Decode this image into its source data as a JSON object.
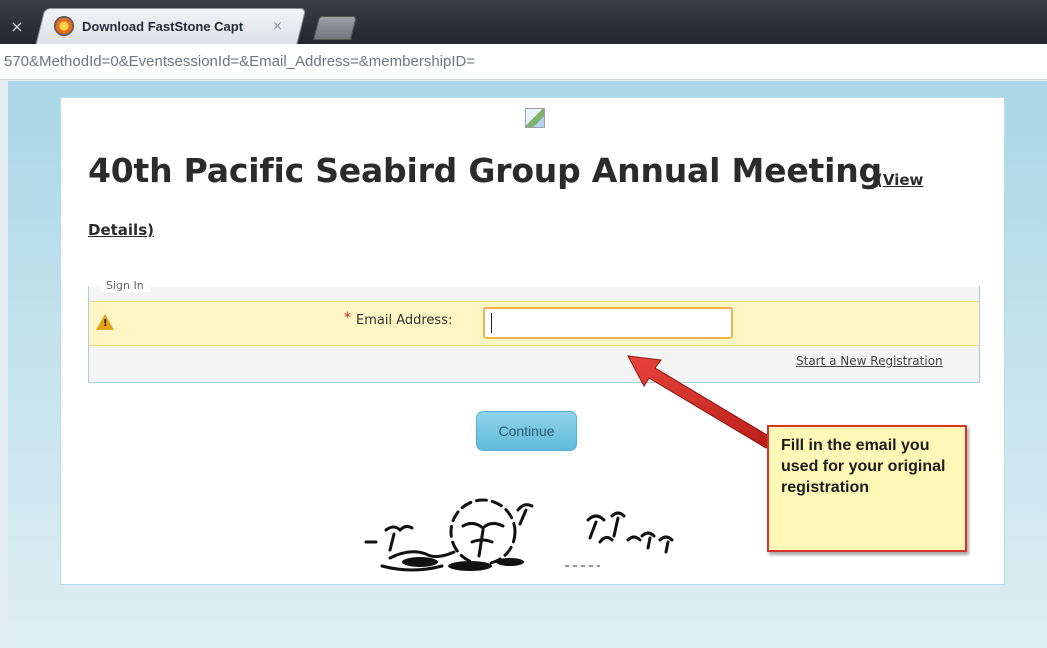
{
  "browser": {
    "prev_tab_close": "×",
    "tab_title": "Download FastStone Capt",
    "tab_close": "×",
    "url": "570&MethodId=0&EventsessionId=&Email_Address=&membershipID="
  },
  "page": {
    "title": "40th Pacific Seabird Group Annual Meeting",
    "view_link": "(View",
    "details_link": "Details)",
    "signin_legend": "Sign In",
    "warning_icon": "warning-triangle-icon",
    "required_marker": "*",
    "email_label": "Email Address:",
    "email_value": "",
    "new_registration_link": "Start a New Registration",
    "continue_button": "Continue"
  },
  "annotation": {
    "callout_text": "Fill in the email you used for your original registration"
  },
  "colors": {
    "callout_border": "#d8322d",
    "callout_bg": "#fff8b6",
    "warning_row_bg": "#fff6c4",
    "button_bg": "#60bcdc"
  }
}
